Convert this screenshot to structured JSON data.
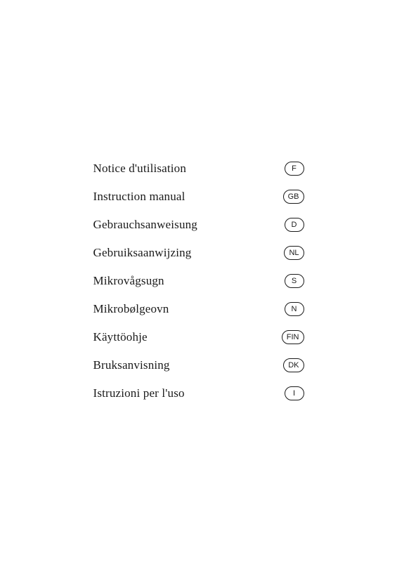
{
  "page": {
    "background": "#ffffff"
  },
  "manuals": [
    {
      "title": "Notice d'utilisation",
      "lang": "F"
    },
    {
      "title": "Instruction manual",
      "lang": "GB"
    },
    {
      "title": "Gebrauchsanweisung",
      "lang": "D"
    },
    {
      "title": "Gebruiksaanwijzing",
      "lang": "NL"
    },
    {
      "title": "Mikrovågsugn",
      "lang": "S"
    },
    {
      "title": "Mikrobølgeovn",
      "lang": "N"
    },
    {
      "title": "Käyttöohje",
      "lang": "FIN"
    },
    {
      "title": "Bruksanvisning",
      "lang": "DK"
    },
    {
      "title": "Istruzioni per l'uso",
      "lang": "I"
    }
  ]
}
